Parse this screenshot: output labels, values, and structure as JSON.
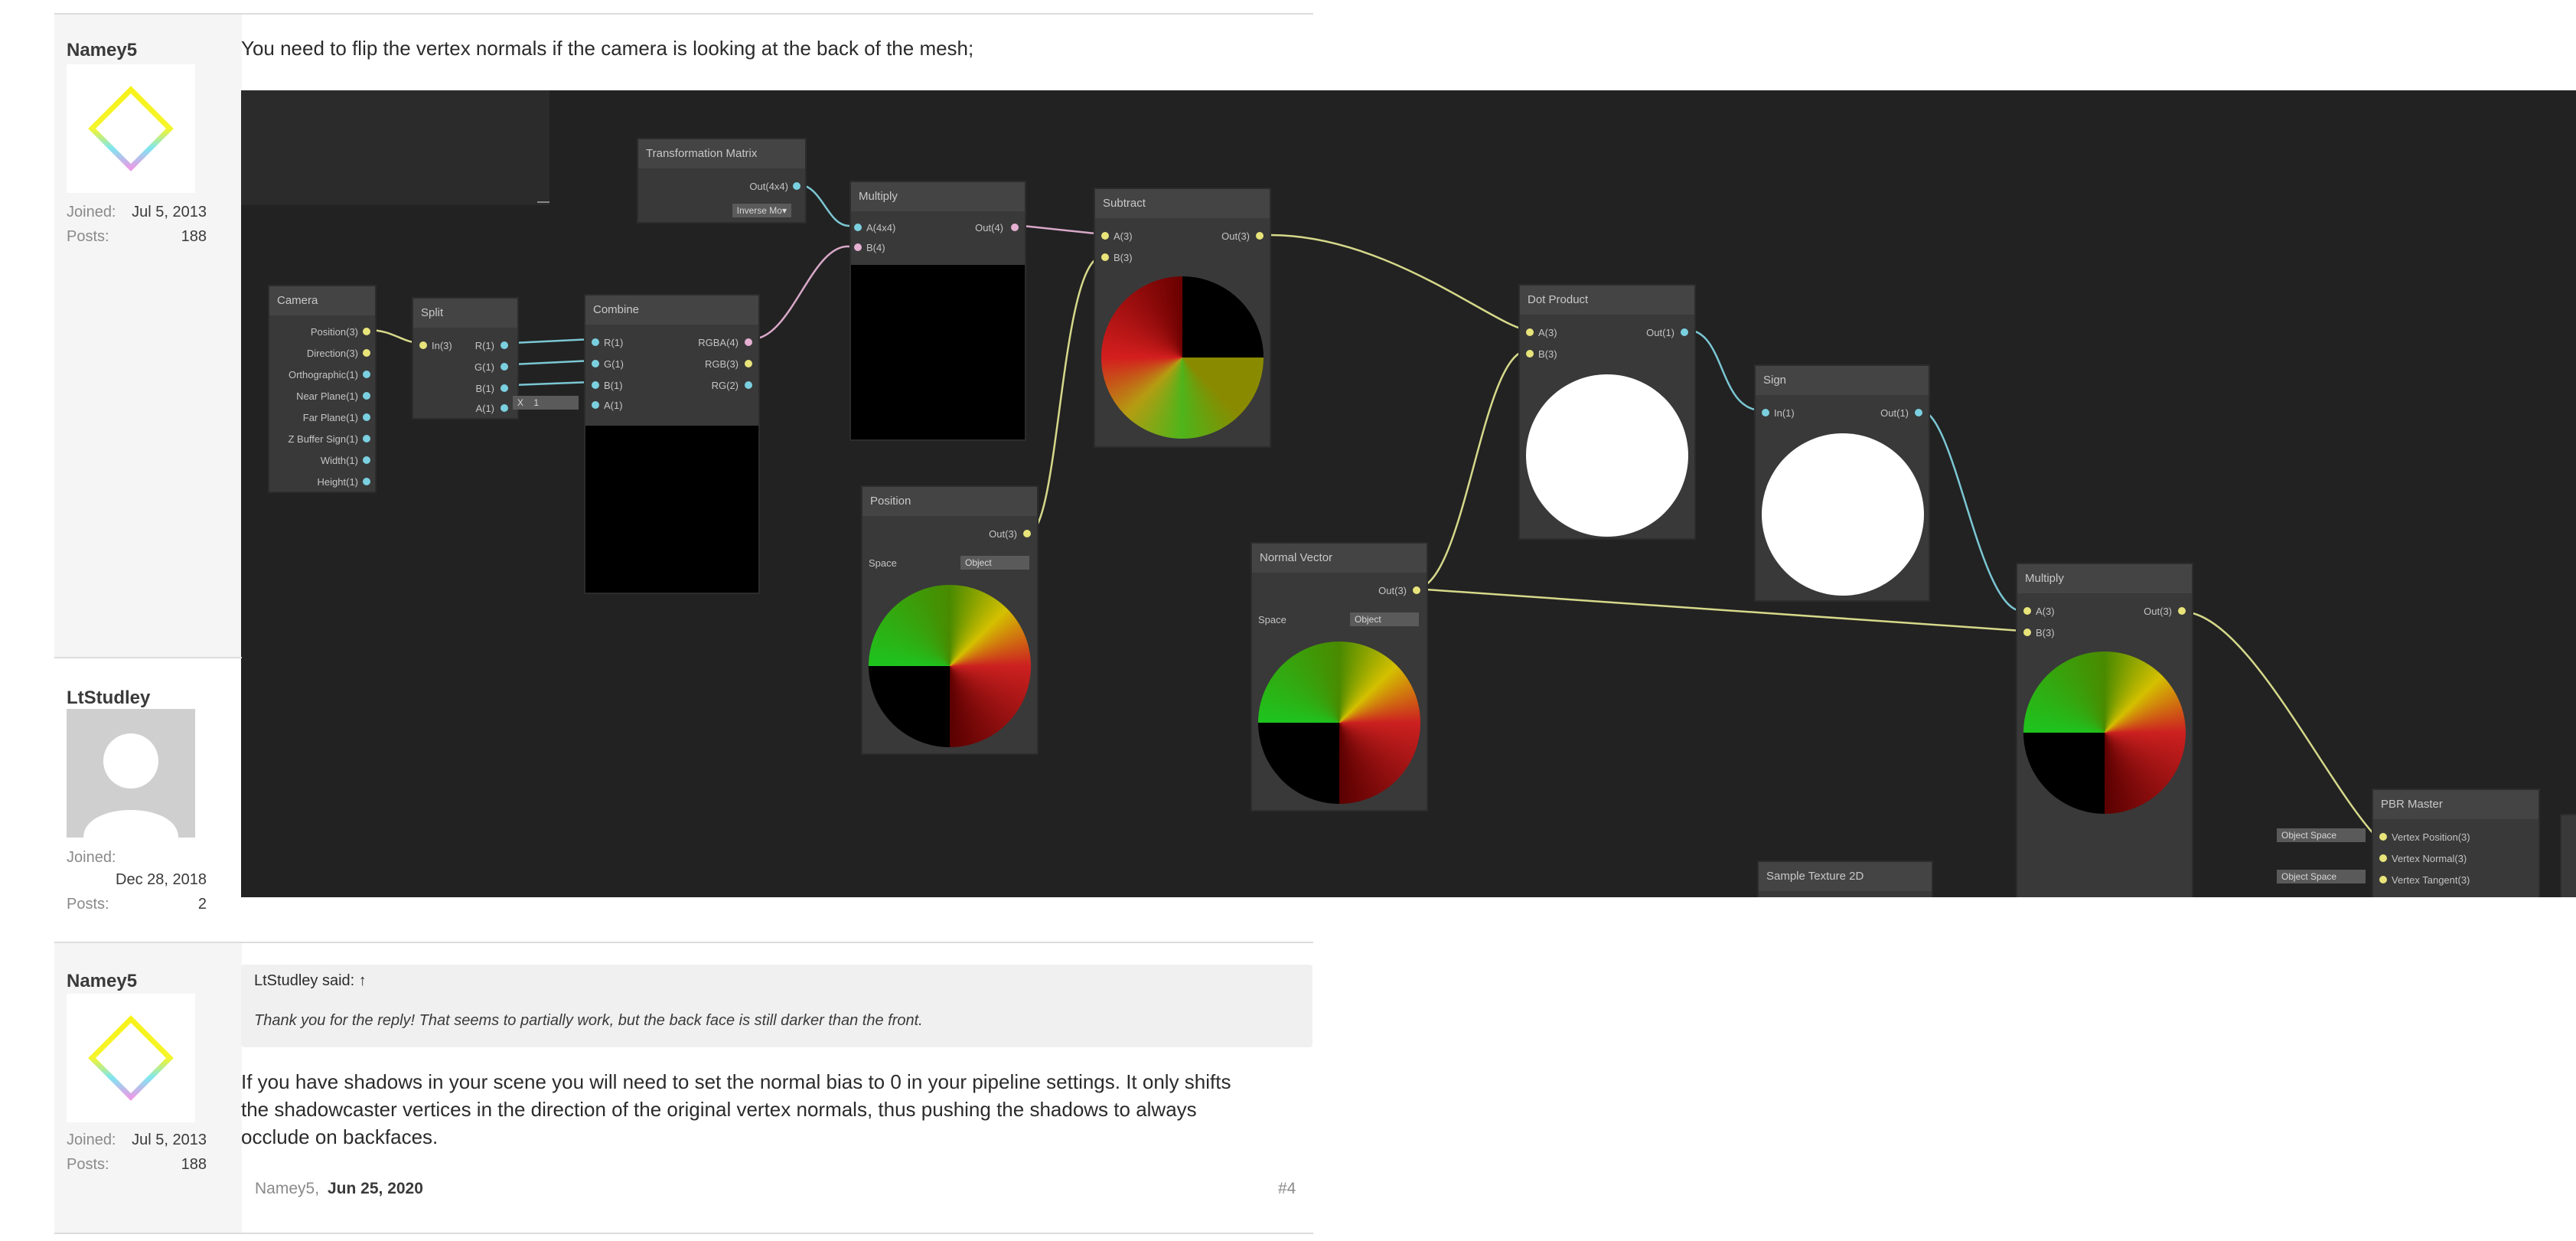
{
  "posts": [
    {
      "username": "Namey5",
      "joined_label": "Joined:",
      "joined": "Jul 5, 2013",
      "posts_label": "Posts:",
      "posts": "188",
      "message": "You need to flip the vertex normals if the camera is looking at the back of the mesh;"
    },
    {
      "username": "LtStudley",
      "joined_label": "Joined:",
      "joined": "Dec 28, 2018",
      "posts_label": "Posts:",
      "posts": "2"
    },
    {
      "username": "Namey5",
      "joined_label": "Joined:",
      "joined": "Jul 5, 2013",
      "posts_label": "Posts:",
      "posts": "188",
      "quote_header": "LtStudley said: ↑",
      "quote_text": "Thank you for the reply! That seems to partially work, but the back face is still darker than the front.",
      "message_lines": [
        "If you have shadows in your scene you will need to set the normal bias to 0 in your pipeline settings. It only shifts",
        "the shadowcaster vertices in the direction of the original vertex normals, thus pushing the shadows to always",
        "occlude on backfaces."
      ],
      "footer_author": "Namey5,",
      "footer_date": "Jun 25, 2020",
      "footer_num": "#4"
    }
  ],
  "graph": {
    "transform": {
      "title": "Transformation Matrix",
      "out": "Out(4x4)",
      "dropdown": "Inverse Mo▾"
    },
    "camera": {
      "title": "Camera",
      "ports": [
        "Position(3)",
        "Direction(3)",
        "Orthographic(1)",
        "Near Plane(1)",
        "Far Plane(1)",
        "Z Buffer Sign(1)",
        "Width(1)",
        "Height(1)"
      ]
    },
    "split": {
      "title": "Split",
      "in": "In(3)",
      "outs": [
        "R(1)",
        "G(1)",
        "B(1)",
        "A(1)"
      ]
    },
    "combine": {
      "title": "Combine",
      "ins": [
        "R(1)",
        "G(1)",
        "B(1)",
        "A(1)"
      ],
      "outs": [
        "RGBA(4)",
        "RGB(3)",
        "RG(2)"
      ],
      "x_label": "X",
      "x_val": "1"
    },
    "multiply1": {
      "title": "Multiply",
      "ins": [
        "A(4x4)",
        "B(4)"
      ],
      "out": "Out(4)"
    },
    "subtract": {
      "title": "Subtract",
      "ins": [
        "A(3)",
        "B(3)"
      ],
      "out": "Out(3)"
    },
    "position": {
      "title": "Position",
      "out": "Out(3)",
      "space_label": "Space",
      "space_val": "Object"
    },
    "normal": {
      "title": "Normal Vector",
      "out": "Out(3)",
      "space_label": "Space",
      "space_val": "Object"
    },
    "dot": {
      "title": "Dot Product",
      "ins": [
        "A(3)",
        "B(3)"
      ],
      "out": "Out(1)"
    },
    "sign": {
      "title": "Sign",
      "in": "In(1)",
      "out": "Out(1)"
    },
    "multiply2": {
      "title": "Multiply",
      "ins": [
        "A(3)",
        "B(3)"
      ],
      "out": "Out(3)"
    },
    "pbr": {
      "title": "PBR Master",
      "ports": [
        "Vertex Position(3)",
        "Vertex Normal(3)",
        "Vertex Tangent(3)"
      ],
      "space_tags": [
        "Object Space",
        "Object Space"
      ]
    },
    "sample": {
      "title": "Sample Texture 2D"
    }
  },
  "colors": {
    "wire_yellow": "#d6d98a",
    "wire_cyan": "#7bc7d4",
    "wire_pink": "#d8a8c8"
  }
}
